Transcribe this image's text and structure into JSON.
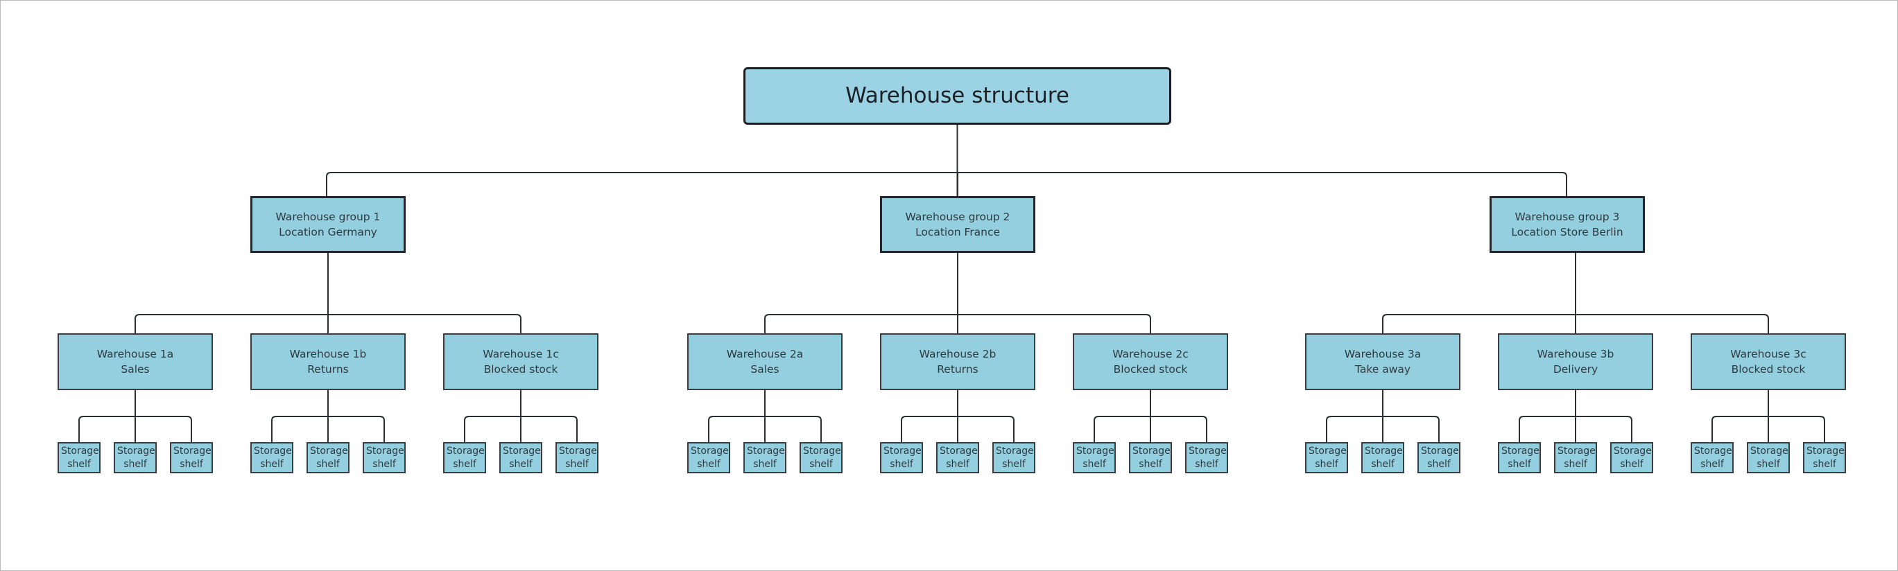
{
  "diagram": {
    "type": "org-chart",
    "root": {
      "label": "Warehouse structure"
    },
    "fill_color": "#93cfdf",
    "line_color": "#2b2f33",
    "groups": [
      {
        "line1": "Warehouse group 1",
        "line2": "Location Germany",
        "warehouses": [
          {
            "line1": "Warehouse 1a",
            "line2": "Sales",
            "shelves": [
              "Storage shelf",
              "Storage shelf",
              "Storage shelf"
            ]
          },
          {
            "line1": "Warehouse 1b",
            "line2": "Returns",
            "shelves": [
              "Storage shelf",
              "Storage shelf",
              "Storage shelf"
            ]
          },
          {
            "line1": "Warehouse 1c",
            "line2": "Blocked stock",
            "shelves": [
              "Storage shelf",
              "Storage shelf",
              "Storage shelf"
            ]
          }
        ]
      },
      {
        "line1": "Warehouse group 2",
        "line2": "Location France",
        "warehouses": [
          {
            "line1": "Warehouse 2a",
            "line2": "Sales",
            "shelves": [
              "Storage shelf",
              "Storage shelf",
              "Storage shelf"
            ]
          },
          {
            "line1": "Warehouse 2b",
            "line2": "Returns",
            "shelves": [
              "Storage shelf",
              "Storage shelf",
              "Storage shelf"
            ]
          },
          {
            "line1": "Warehouse 2c",
            "line2": "Blocked stock",
            "shelves": [
              "Storage shelf",
              "Storage shelf",
              "Storage shelf"
            ]
          }
        ]
      },
      {
        "line1": "Warehouse group 3",
        "line2": "Location Store Berlin",
        "warehouses": [
          {
            "line1": "Warehouse 3a",
            "line2": "Take away",
            "shelves": [
              "Storage shelf",
              "Storage shelf",
              "Storage shelf"
            ]
          },
          {
            "line1": "Warehouse 3b",
            "line2": "Delivery",
            "shelves": [
              "Storage shelf",
              "Storage shelf",
              "Storage shelf"
            ]
          },
          {
            "line1": "Warehouse 3c",
            "line2": "Blocked stock",
            "shelves": [
              "Storage shelf",
              "Storage shelf",
              "Storage shelf"
            ]
          }
        ]
      }
    ]
  }
}
